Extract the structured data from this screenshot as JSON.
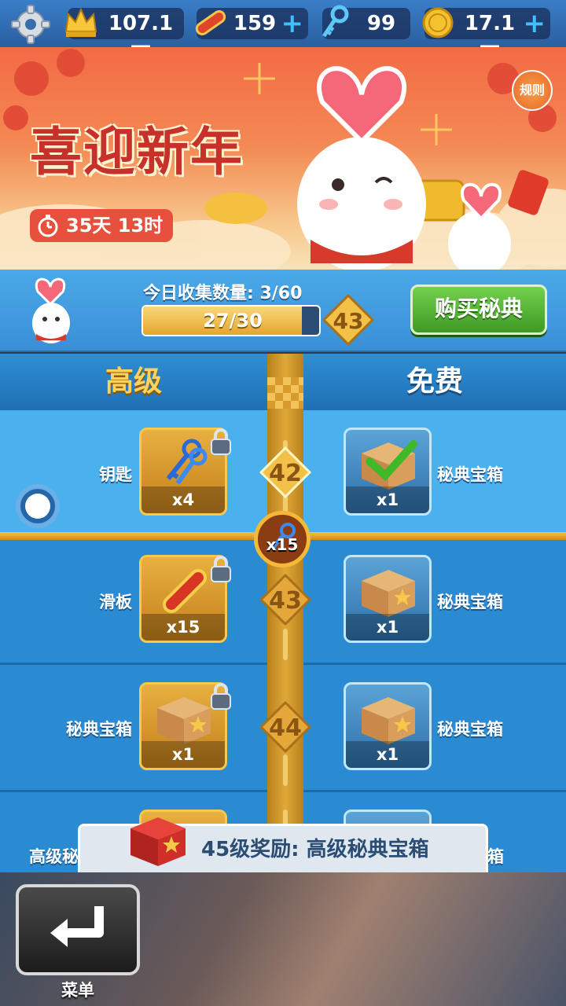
{
  "topbar": {
    "crown": {
      "value": "107.1万",
      "icon": "crown-icon"
    },
    "skateboard": {
      "value": "159",
      "icon": "skateboard-icon",
      "plus": "+"
    },
    "key": {
      "value": "99",
      "icon": "key-icon"
    },
    "coin": {
      "value": "17.1万",
      "icon": "coin-icon",
      "plus": "+"
    }
  },
  "banner": {
    "title": "喜迎新年",
    "timer": "35天 13时",
    "rules": "规则"
  },
  "status": {
    "collect_label": "今日收集数量: 3/60",
    "progress_text": "27/30",
    "progress_fraction": 0.9,
    "level": "43",
    "buy_button": "购买秘典"
  },
  "columns": {
    "premium": "高级",
    "free": "免费"
  },
  "rows": [
    {
      "level": "42",
      "premium": {
        "name": "钥匙",
        "qty": "x4",
        "icon": "keys-icon",
        "locked": true
      },
      "free": {
        "name": "秘典宝箱",
        "qty": "x1",
        "icon": "chest-icon",
        "claimed": true
      }
    },
    {
      "level": "43",
      "premium": {
        "name": "滑板",
        "qty": "x15",
        "icon": "skateboard-icon",
        "locked": true
      },
      "free": {
        "name": "秘典宝箱",
        "qty": "x1",
        "icon": "chest-icon",
        "claimed": false
      }
    },
    {
      "level": "44",
      "premium": {
        "name": "秘典宝箱",
        "qty": "x1",
        "icon": "chest-icon",
        "locked": true
      },
      "free": {
        "name": "秘典宝箱",
        "qty": "x1",
        "icon": "chest-icon",
        "claimed": false
      }
    },
    {
      "level": "",
      "premium": {
        "name": "高级秘",
        "qty": "",
        "icon": "chest-icon",
        "locked": true
      },
      "free": {
        "name": "箱",
        "qty": "",
        "icon": "chest-icon",
        "claimed": false
      }
    }
  ],
  "marker": {
    "qty": "x15",
    "icon": "keys-icon"
  },
  "reward_banner": {
    "text": "45级奖励: 高级秘典宝箱",
    "icon": "red-chest-icon"
  },
  "menu": {
    "label": "菜单",
    "icon": "return-arrow-icon"
  }
}
